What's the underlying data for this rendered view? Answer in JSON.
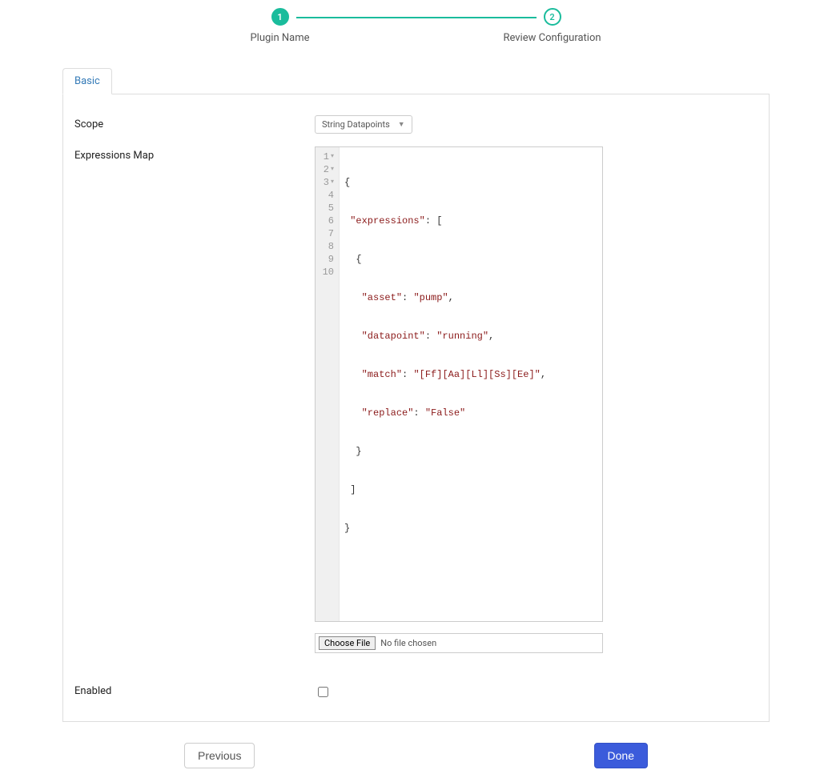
{
  "stepper": {
    "step1": {
      "num": "1",
      "label": "Plugin Name"
    },
    "step2": {
      "num": "2",
      "label": "Review Configuration"
    }
  },
  "tabs": {
    "basic": "Basic"
  },
  "form": {
    "scope_label": "Scope",
    "scope_value": "String Datapoints",
    "expressions_label": "Expressions Map",
    "enabled_label": "Enabled",
    "file_button": "Choose File",
    "file_status": "No file chosen"
  },
  "code": {
    "gutter": [
      "1",
      "2",
      "3",
      "4",
      "5",
      "6",
      "7",
      "8",
      "9",
      "10"
    ],
    "l1_open": "{",
    "l2_key": "\"expressions\"",
    "l2_colon": ": [",
    "l3": "  {",
    "l4_key": "\"asset\"",
    "l4_val": "\"pump\"",
    "l4_end": ",",
    "l5_key": "\"datapoint\"",
    "l5_val": "\"running\"",
    "l5_end": ",",
    "l6_key": "\"match\"",
    "l6_val": "\"[Ff][Aa][Ll][Ss][Ee]\"",
    "l6_end": ",",
    "l7_key": "\"replace\"",
    "l7_val": "\"False\"",
    "l8": "  }",
    "l9": " ]",
    "l10": "}"
  },
  "expressions_value": {
    "expressions": [
      {
        "asset": "pump",
        "datapoint": "running",
        "match": "[Ff][Aa][Ll][Ss][Ee]",
        "replace": "False"
      }
    ]
  },
  "buttons": {
    "previous": "Previous",
    "done": "Done"
  }
}
